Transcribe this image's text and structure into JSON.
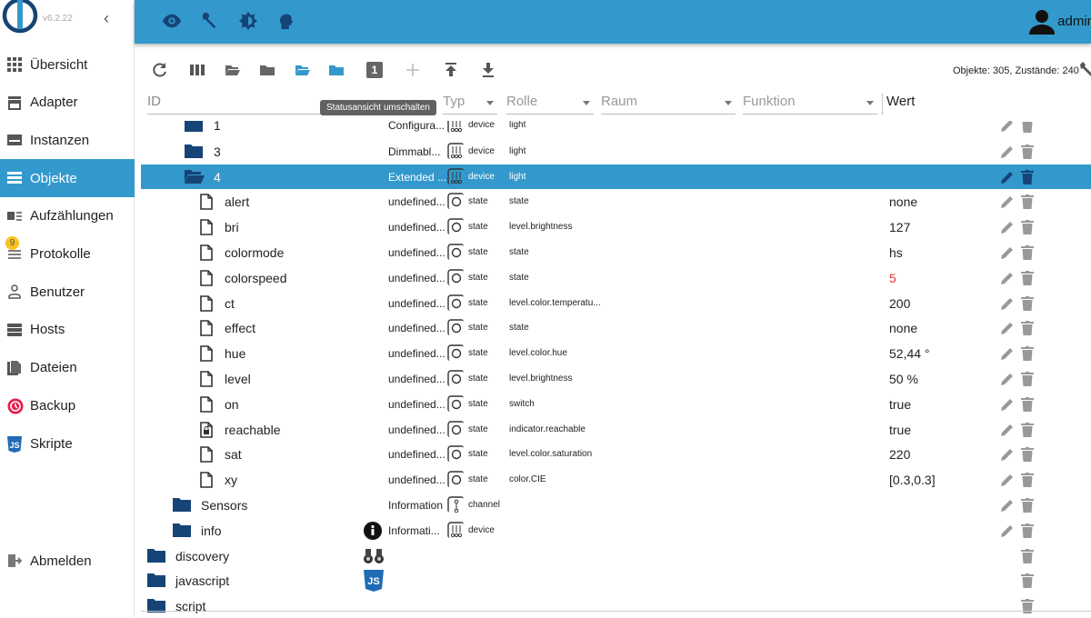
{
  "app": {
    "version": "v6.2.22",
    "user": "admin",
    "accent": "#3399cc"
  },
  "sidebar": {
    "items": [
      {
        "label": "Übersicht",
        "icon": "apps-icon"
      },
      {
        "label": "Adapter",
        "icon": "store-icon"
      },
      {
        "label": "Instanzen",
        "icon": "instances-icon"
      },
      {
        "label": "Objekte",
        "icon": "list-icon",
        "active": true
      },
      {
        "label": "Aufzählungen",
        "icon": "enums-icon"
      },
      {
        "label": "Protokolle",
        "icon": "logs-icon",
        "badge": "9"
      },
      {
        "label": "Benutzer",
        "icon": "user-icon"
      },
      {
        "label": "Hosts",
        "icon": "hosts-icon"
      },
      {
        "label": "Dateien",
        "icon": "files-icon"
      },
      {
        "label": "Backup",
        "icon": "backup-icon"
      },
      {
        "label": "Skripte",
        "icon": "js-icon"
      }
    ],
    "logout": "Abmelden"
  },
  "toolbar": {
    "counts": "Objekte: 305, Zustände: 240",
    "tooltip": "Statusansicht umschalten",
    "toggle_label": "1"
  },
  "columns": {
    "id": "ID",
    "type": "Typ",
    "role": "Rolle",
    "room": "Raum",
    "function": "Funktion",
    "value": "Wert"
  },
  "rows": [
    {
      "name": "1",
      "desc": "Configura...",
      "type": "device",
      "role": "light",
      "level": 1,
      "kind": "folder",
      "partial": true
    },
    {
      "name": "3",
      "desc": "Dimmabl...",
      "type": "device",
      "role": "light",
      "level": 1,
      "kind": "folder"
    },
    {
      "name": "4",
      "desc": "Extended ...",
      "type": "device",
      "role": "light",
      "level": 1,
      "kind": "folder-open",
      "selected": true
    },
    {
      "name": "alert",
      "desc": "undefined...",
      "type": "state",
      "role": "state",
      "value": "none",
      "level": 2,
      "kind": "file"
    },
    {
      "name": "bri",
      "desc": "undefined...",
      "type": "state",
      "role": "level.brightness",
      "value": "127",
      "level": 2,
      "kind": "file"
    },
    {
      "name": "colormode",
      "desc": "undefined...",
      "type": "state",
      "role": "state",
      "value": "hs",
      "level": 2,
      "kind": "file"
    },
    {
      "name": "colorspeed",
      "desc": "undefined...",
      "type": "state",
      "role": "state",
      "value": "5",
      "value_color": "#e53935",
      "level": 2,
      "kind": "file"
    },
    {
      "name": "ct",
      "desc": "undefined...",
      "type": "state",
      "role": "level.color.temperatu...",
      "value": "200",
      "level": 2,
      "kind": "file"
    },
    {
      "name": "effect",
      "desc": "undefined...",
      "type": "state",
      "role": "state",
      "value": "none",
      "level": 2,
      "kind": "file"
    },
    {
      "name": "hue",
      "desc": "undefined...",
      "type": "state",
      "role": "level.color.hue",
      "value": "52,44 °",
      "level": 2,
      "kind": "file"
    },
    {
      "name": "level",
      "desc": "undefined...",
      "type": "state",
      "role": "level.brightness",
      "value": "50 %",
      "level": 2,
      "kind": "file"
    },
    {
      "name": "on",
      "desc": "undefined...",
      "type": "state",
      "role": "switch",
      "value": "true",
      "level": 2,
      "kind": "file"
    },
    {
      "name": "reachable",
      "desc": "undefined...",
      "type": "state",
      "role": "indicator.reachable",
      "value": "true",
      "level": 2,
      "kind": "file-lock"
    },
    {
      "name": "sat",
      "desc": "undefined...",
      "type": "state",
      "role": "level.color.saturation",
      "value": "220",
      "level": 2,
      "kind": "file"
    },
    {
      "name": "xy",
      "desc": "undefined...",
      "type": "state",
      "role": "color.CIE",
      "value": "[0.3,0.3]",
      "level": 2,
      "kind": "file"
    },
    {
      "name": "Sensors",
      "desc": "Information",
      "type": "channel",
      "role": "",
      "level": 0.5,
      "kind": "folder"
    },
    {
      "name": "info",
      "desc": "Informati...",
      "type": "device",
      "role": "",
      "level": 0.5,
      "kind": "folder",
      "info": true
    },
    {
      "name": "discovery",
      "level": 0,
      "kind": "folder",
      "adapter_icon": "binoculars-icon",
      "noedit": true
    },
    {
      "name": "javascript",
      "level": 0,
      "kind": "folder",
      "adapter_icon": "js-icon",
      "noedit": true
    },
    {
      "name": "script",
      "level": 0,
      "kind": "folder",
      "noedit": true
    }
  ]
}
